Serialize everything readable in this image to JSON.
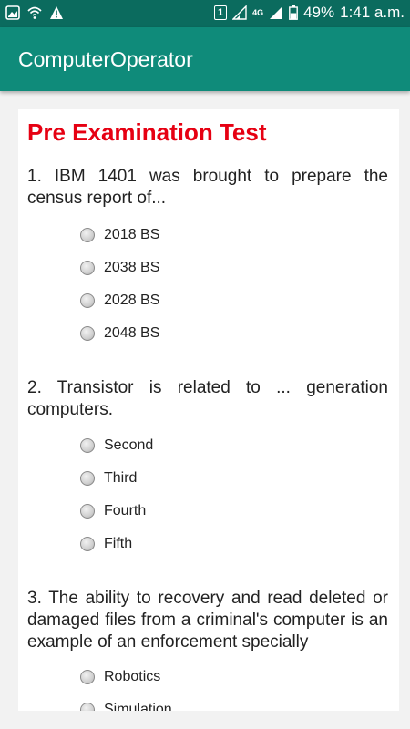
{
  "status_bar": {
    "network": "4G",
    "battery": "49%",
    "time": "1:41 a.m.",
    "sim": "1"
  },
  "app_bar": {
    "title": "ComputerOperator"
  },
  "page": {
    "title": "Pre Examination Test"
  },
  "questions": [
    {
      "text": "1. IBM 1401 was brought to prepare the census report of...",
      "options": [
        "2018 BS",
        "2038 BS",
        "2028 BS",
        "2048 BS"
      ]
    },
    {
      "text": "2. Transistor is related to ... generation computers.",
      "options": [
        "Second",
        "Third",
        "Fourth",
        "Fifth"
      ]
    },
    {
      "text": "3. The ability to recovery and read deleted or damaged files from a criminal's computer is an example of an enforcement specially",
      "options": [
        "Robotics",
        "Simulation"
      ]
    }
  ]
}
